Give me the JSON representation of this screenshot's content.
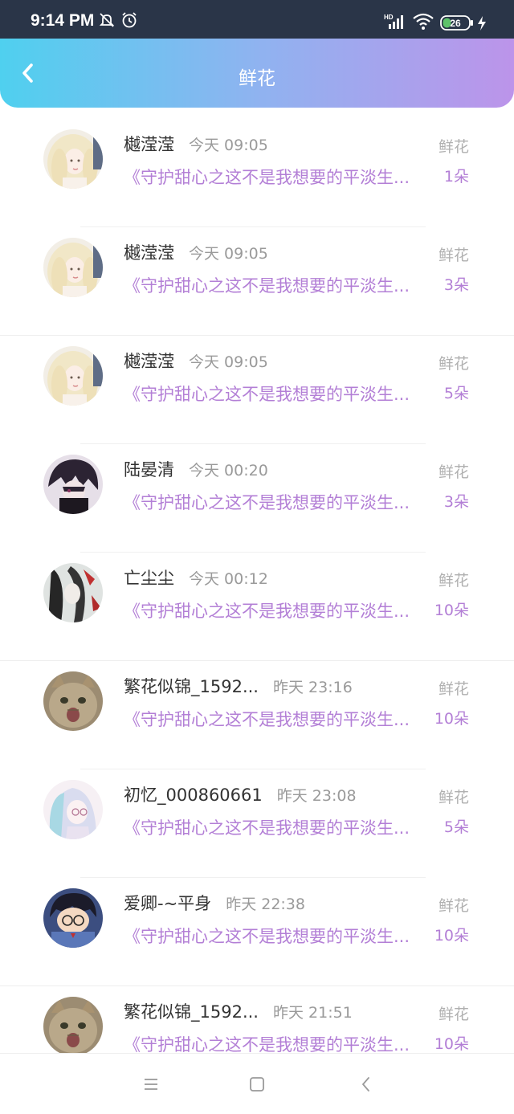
{
  "status_bar": {
    "time": "9:14 PM",
    "network": "HD",
    "battery": "26",
    "icons": [
      "notification-muted-icon",
      "alarm-icon",
      "signal-icon",
      "wifi-icon",
      "battery-icon",
      "charging-icon"
    ]
  },
  "header": {
    "title": "鲜花",
    "back_icon": "chevron-left-icon"
  },
  "rows": [
    {
      "username": "樾滢滢",
      "time": "今天 09:05",
      "work": "《守护甜心之这不是我想要的平淡生...",
      "gift": "鲜花",
      "count": "1朵",
      "avatar": "girl-blonde"
    },
    {
      "username": "樾滢滢",
      "time": "今天 09:05",
      "work": "《守护甜心之这不是我想要的平淡生...",
      "gift": "鲜花",
      "count": "3朵",
      "avatar": "girl-blonde"
    },
    {
      "username": "樾滢滢",
      "time": "今天 09:05",
      "work": "《守护甜心之这不是我想要的平淡生...",
      "gift": "鲜花",
      "count": "5朵",
      "avatar": "girl-blonde"
    },
    {
      "username": "陆晏清",
      "time": "今天 00:20",
      "work": "《守护甜心之这不是我想要的平淡生...",
      "gift": "鲜花",
      "count": "3朵",
      "avatar": "boy-dark"
    },
    {
      "username": "亡尘尘",
      "time": "今天 00:12",
      "work": "《守护甜心之这不是我想要的平淡生...",
      "gift": "鲜花",
      "count": "10朵",
      "avatar": "ink-figure"
    },
    {
      "username": "繁花似锦_1592...",
      "time": "昨天 23:16",
      "work": "《守护甜心之这不是我想要的平淡生...",
      "gift": "鲜花",
      "count": "10朵",
      "avatar": "cat"
    },
    {
      "username": "初忆_000860661",
      "time": "昨天 23:08",
      "work": "《守护甜心之这不是我想要的平淡生...",
      "gift": "鲜花",
      "count": "5朵",
      "avatar": "girl-pastel"
    },
    {
      "username": "爱卿-~平身",
      "time": "昨天 22:38",
      "work": "《守护甜心之这不是我想要的平淡生...",
      "gift": "鲜花",
      "count": "10朵",
      "avatar": "detective"
    },
    {
      "username": "繁花似锦_1592...",
      "time": "昨天 21:51",
      "work": "《守护甜心之这不是我想要的平淡生...",
      "gift": "鲜花",
      "count": "10朵",
      "avatar": "cat"
    }
  ],
  "nav_bar": {
    "buttons": [
      "menu-icon",
      "home-icon",
      "back-icon"
    ]
  },
  "colors": {
    "header_gradient_start": "#4fd0ef",
    "header_gradient_end": "#bc94ea",
    "accent_purple": "#b37fd6",
    "muted_gray": "#9a9a9a"
  }
}
